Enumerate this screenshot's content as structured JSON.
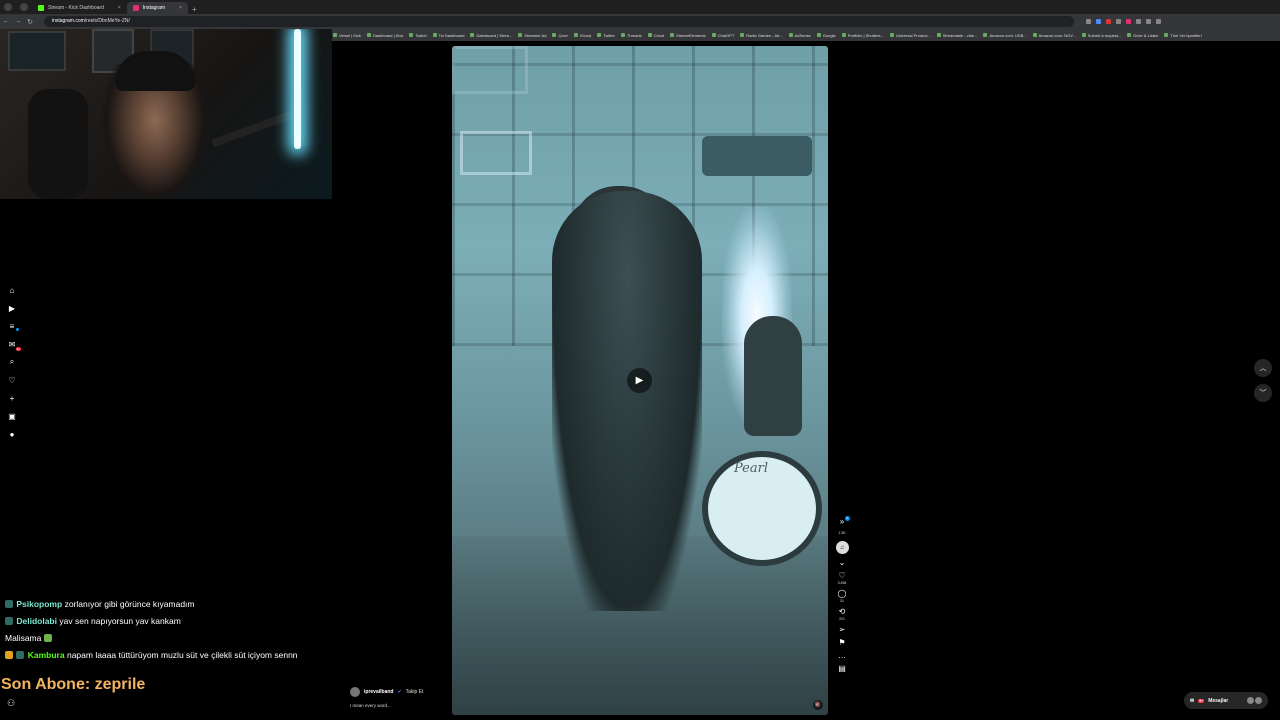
{
  "browser": {
    "tabs": [
      {
        "title": "Stream - Kick Dashboard",
        "fav_color": "#53fc18",
        "active": false
      },
      {
        "title": "Instagram",
        "fav_color": "#e1306c",
        "active": true
      }
    ],
    "url_host": "instagram.com",
    "url_path": "/reels/DbnMeYe-ZN/",
    "bookmarks": [
      "Versel | Kick",
      "Dashboard | Kick",
      "Twitch",
      "Tw Dashboard",
      "Dashboard | Strea...",
      "Streamer Ad",
      "Çevir",
      "iCloud",
      "Twitter",
      "Threads",
      "Cricut",
      "StreamElements",
      "ChatGPT",
      "Radio Garden - Alt...",
      "AdSense",
      "Google",
      "Portfolio | Shutters...",
      "Universal Product...",
      "Streamable - vide...",
      "Amazon.com: USB...",
      "Amazon.com: NOV...",
      "Submit a request...",
      "Drive & Listen",
      "Tüm Yer İşaretleri"
    ]
  },
  "stream": {
    "chat": [
      {
        "user": "Psikopomp",
        "user_color": "#7ee8d4",
        "text": "zorlanıyor gibi görünce kıyamadım",
        "emote_color": "#7ee8d4"
      },
      {
        "user": "Delidolabi",
        "user_color": "#7ee8d4",
        "text": "yav sen napıyorsun yav kankam",
        "emote_color": "#7ee8d4"
      },
      {
        "user": "",
        "user_color": "#fff",
        "text": "Malisama",
        "emote_color": "#6fb04a"
      },
      {
        "user": "Kambura",
        "user_color": "#53fc18",
        "text": "napam laaaa tüttürüyom muzlu süt ve çilekli süt içiyom sennn",
        "emote_color": "#e0a020"
      }
    ],
    "last_sub_label": "Son Abone: zeprile"
  },
  "reel": {
    "author": "iprevailband",
    "follow_label": "Takip Et",
    "caption": "I mean every word...",
    "drum_brand": "Pearl",
    "play_icon": "play-icon"
  },
  "actions": {
    "audio_count": "1.3K",
    "like_count": "3.456",
    "comment_count": "31",
    "share_count": "221",
    "notif_count": "4"
  },
  "nav_badge": "9+",
  "messages": {
    "label": "Mesajlar",
    "badge": "9+"
  }
}
